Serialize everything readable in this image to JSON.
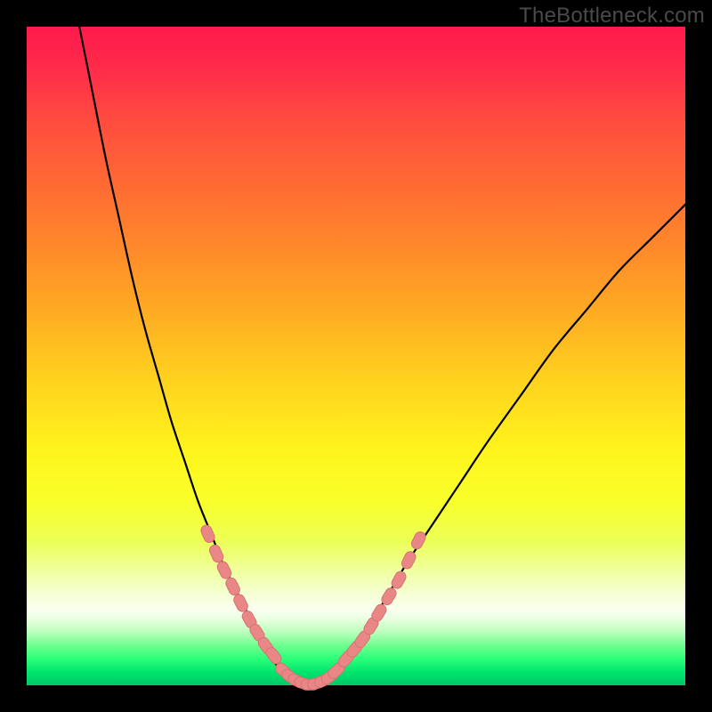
{
  "watermark": "TheBottleneck.com",
  "colors": {
    "curve_stroke": "#000000",
    "marker_fill": "#e98787",
    "marker_stroke": "#d77272",
    "gradient_top": "#ff1a4d",
    "gradient_bottom": "#00c868"
  },
  "chart_data": {
    "type": "line",
    "title": "",
    "xlabel": "",
    "ylabel": "",
    "xlim": [
      0,
      100
    ],
    "ylim": [
      0,
      100
    ],
    "grid": false,
    "legend": false,
    "annotations": [
      "TheBottleneck.com"
    ],
    "note": "Axes are unlabeled in the source image; x and y values are estimated on a 0–100 scale from pixel positions. y≈0 corresponds to the bottom (green) and y≈100 to the top (red).",
    "series": [
      {
        "name": "left-branch",
        "x": [
          8,
          10,
          12,
          14,
          16,
          18,
          20,
          22,
          24,
          26,
          28,
          30,
          32,
          34,
          36,
          38,
          40
        ],
        "y": [
          100,
          90,
          80,
          71,
          62,
          54,
          47,
          40,
          34,
          28,
          23,
          18,
          14,
          10,
          6,
          3,
          1
        ]
      },
      {
        "name": "valley-floor",
        "x": [
          40,
          41,
          42,
          43,
          44,
          45,
          46
        ],
        "y": [
          1,
          0.4,
          0.1,
          0,
          0.1,
          0.4,
          1
        ]
      },
      {
        "name": "right-branch",
        "x": [
          46,
          48,
          50,
          52,
          55,
          58,
          62,
          66,
          70,
          75,
          80,
          85,
          90,
          95,
          100
        ],
        "y": [
          1,
          3,
          6,
          9,
          14,
          19,
          25,
          31,
          37,
          44,
          51,
          57,
          63,
          68,
          73
        ]
      }
    ],
    "marker_clusters": [
      {
        "name": "left-markers",
        "note": "Pill-shaped salmon markers along the left descending branch, roughly between y≈22 and y≈4.",
        "points": [
          {
            "x": 27.5,
            "y": 23
          },
          {
            "x": 28.8,
            "y": 20
          },
          {
            "x": 30.0,
            "y": 17.5
          },
          {
            "x": 31.3,
            "y": 15
          },
          {
            "x": 32.5,
            "y": 12.5
          },
          {
            "x": 33.8,
            "y": 10
          },
          {
            "x": 35.0,
            "y": 8
          },
          {
            "x": 36.3,
            "y": 6
          },
          {
            "x": 37.5,
            "y": 4.5
          }
        ]
      },
      {
        "name": "bottom-markers",
        "note": "Dense cluster of salmon markers across the valley floor.",
        "points": [
          {
            "x": 39,
            "y": 2.2
          },
          {
            "x": 40,
            "y": 1.3
          },
          {
            "x": 41,
            "y": 0.7
          },
          {
            "x": 42,
            "y": 0.3
          },
          {
            "x": 43,
            "y": 0.1
          },
          {
            "x": 44,
            "y": 0.3
          },
          {
            "x": 45,
            "y": 0.7
          },
          {
            "x": 46,
            "y": 1.3
          },
          {
            "x": 47,
            "y": 2.2
          }
        ]
      },
      {
        "name": "right-markers",
        "note": "Salmon markers along the right ascending branch, roughly between y≈4 and y≈22.",
        "points": [
          {
            "x": 48.5,
            "y": 4
          },
          {
            "x": 49.8,
            "y": 5.5
          },
          {
            "x": 51.0,
            "y": 7
          },
          {
            "x": 52.3,
            "y": 9
          },
          {
            "x": 53.5,
            "y": 11
          },
          {
            "x": 55.0,
            "y": 13.5
          },
          {
            "x": 56.5,
            "y": 16
          },
          {
            "x": 58.0,
            "y": 19
          },
          {
            "x": 59.5,
            "y": 22
          }
        ]
      }
    ]
  }
}
